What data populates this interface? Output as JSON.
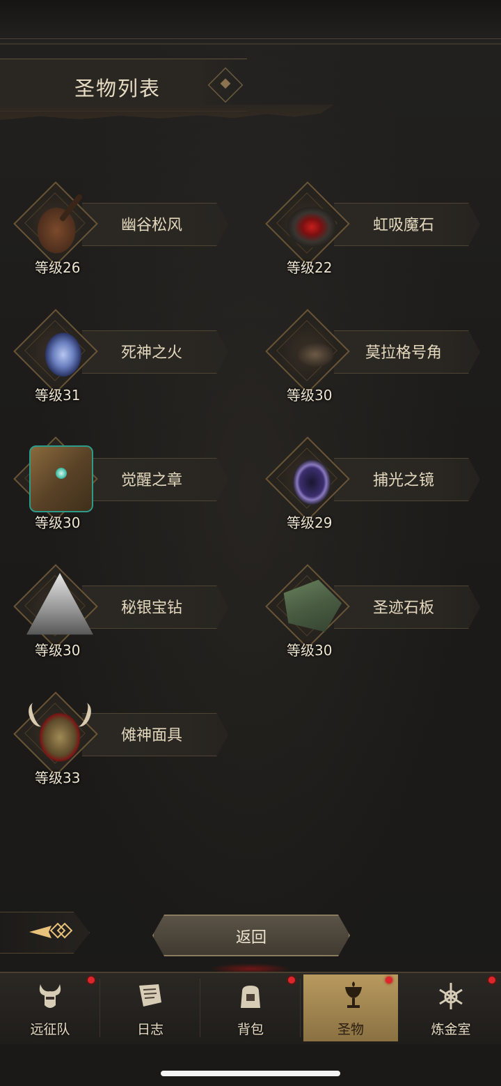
{
  "header": {
    "title": "圣物列表"
  },
  "relics": [
    {
      "name": "幽谷松风",
      "level": "等级26",
      "icon": "lute-icon"
    },
    {
      "name": "虹吸魔石",
      "level": "等级22",
      "icon": "red-stone-icon"
    },
    {
      "name": "死神之火",
      "level": "等级31",
      "icon": "spectral-hand-icon"
    },
    {
      "name": "莫拉格号角",
      "level": "等级30",
      "icon": "horn-icon"
    },
    {
      "name": "觉醒之章",
      "level": "等级30",
      "icon": "book-icon"
    },
    {
      "name": "捕光之镜",
      "level": "等级29",
      "icon": "mirror-icon"
    },
    {
      "name": "秘银宝钻",
      "level": "等级30",
      "icon": "pyramid-icon"
    },
    {
      "name": "圣迹石板",
      "level": "等级30",
      "icon": "stone-slab-icon"
    },
    {
      "name": "傩神面具",
      "level": "等级33",
      "icon": "mask-icon"
    }
  ],
  "footer": {
    "back_label": "返回",
    "collapse_icon": "arrow-left-diamond-icon"
  },
  "tabbar": {
    "tabs": [
      {
        "label": "远征队",
        "icon": "horned-helmet-icon",
        "badge": true,
        "active": false
      },
      {
        "label": "日志",
        "icon": "scroll-icon",
        "badge": false,
        "active": false
      },
      {
        "label": "背包",
        "icon": "bag-icon",
        "badge": true,
        "active": false
      },
      {
        "label": "圣物",
        "icon": "chalice-icon",
        "badge": true,
        "active": true
      },
      {
        "label": "炼金室",
        "icon": "alchemy-icon",
        "badge": true,
        "active": false
      }
    ]
  },
  "colors": {
    "accent": "#b89a5f",
    "badge": "#e0242b",
    "background": "#1b1a18"
  }
}
